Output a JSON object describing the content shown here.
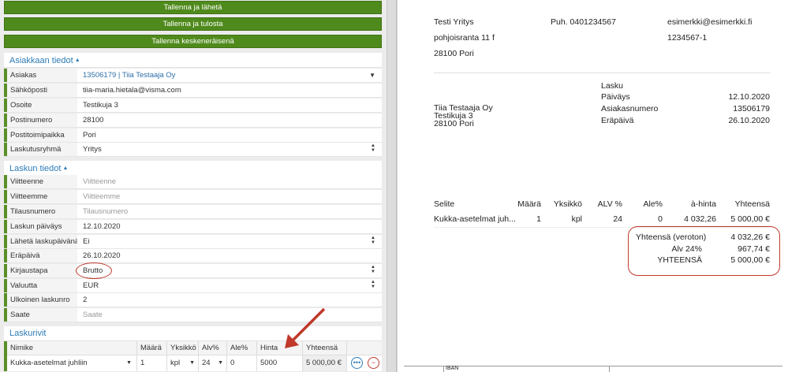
{
  "buttons": {
    "save_send": "Tallenna ja lähetä",
    "save_print": "Tallenna ja tulosta",
    "save_draft": "Tallenna keskeneräisenä"
  },
  "customer": {
    "title": "Asiakkaan tiedot",
    "fields": [
      {
        "label": "Asiakas",
        "value": "13506179 | Tiia Testaaja Oy"
      },
      {
        "label": "Sähköposti",
        "value": "tiia-maria.hietala@visma.com"
      },
      {
        "label": "Osoite",
        "value": "Testikuja 3"
      },
      {
        "label": "Postinumero",
        "value": "28100"
      },
      {
        "label": "Postitoimipaikka",
        "value": "Pori"
      },
      {
        "label": "Laskutusryhmä",
        "value": "Yritys"
      }
    ]
  },
  "invoice": {
    "title": "Laskun tiedot",
    "fields": [
      {
        "label": "Viitteenne",
        "placeholder": "Viitteenne"
      },
      {
        "label": "Viitteemme",
        "placeholder": "Viitteemme"
      },
      {
        "label": "Tilausnumero",
        "placeholder": "Tilausnumero"
      },
      {
        "label": "Laskun päiväys",
        "value": "12.10.2020"
      },
      {
        "label": "Lähetä laskupäivänä",
        "value": "Ei"
      },
      {
        "label": "Eräpäivä",
        "value": "26.10.2020"
      },
      {
        "label": "Kirjaustapa",
        "value": "Brutto"
      },
      {
        "label": "Valuutta",
        "value": "EUR"
      },
      {
        "label": "Ulkoinen laskunro",
        "value": "2"
      },
      {
        "label": "Saate",
        "placeholder": "Saate"
      }
    ]
  },
  "lines": {
    "title": "Laskurivit",
    "headers": [
      "Nimike",
      "Määrä",
      "Yksikkö",
      "Alv%",
      "Ale%",
      "Hinta",
      "Yhteensä"
    ],
    "row": {
      "item": "Kukka-asetelmat juhliin",
      "qty": "1",
      "unit": "kpl",
      "vat": "24",
      "discount": "0",
      "price": "5000",
      "total": "5 000,00 €"
    }
  },
  "preview": {
    "company": "Testi Yritys",
    "street": "pohjoisranta 11 f",
    "postal": "28100 Pori",
    "phone": "Puh. 0401234567",
    "email": "esimerkki@esimerkki.fi",
    "business_id": "1234567-1",
    "recipient": {
      "name": "Tiia Testaaja Oy",
      "street": "Testikuja 3",
      "postal": "28100 Pori"
    },
    "doc_title": "Lasku",
    "meta": [
      {
        "label": "Päiväys",
        "value": "12.10.2020"
      },
      {
        "label": "Asiakasnumero",
        "value": "13506179"
      },
      {
        "label": "Eräpäivä",
        "value": "26.10.2020"
      }
    ],
    "table_headers": [
      "Selite",
      "Määrä",
      "Yksikkö",
      "ALV %",
      "Ale%",
      "à-hinta",
      "Yhteensä"
    ],
    "table_row": [
      "Kukka-asetelmat juh...",
      "1",
      "kpl",
      "24",
      "0",
      "4 032,26",
      "5 000,00 €"
    ],
    "totals": [
      {
        "label": "Yhteensä (veroton)",
        "value": "4 032,26 €"
      },
      {
        "label": "Alv 24%",
        "value": "967,74 €"
      },
      {
        "label": "YHTEENSÄ",
        "value": "5 000,00 €"
      }
    ],
    "footer_iban": "IBAN"
  },
  "colors": {
    "accent_green": "#4f8a1c",
    "link_blue": "#2c7bb6",
    "annotation_red": "#c0392b"
  }
}
